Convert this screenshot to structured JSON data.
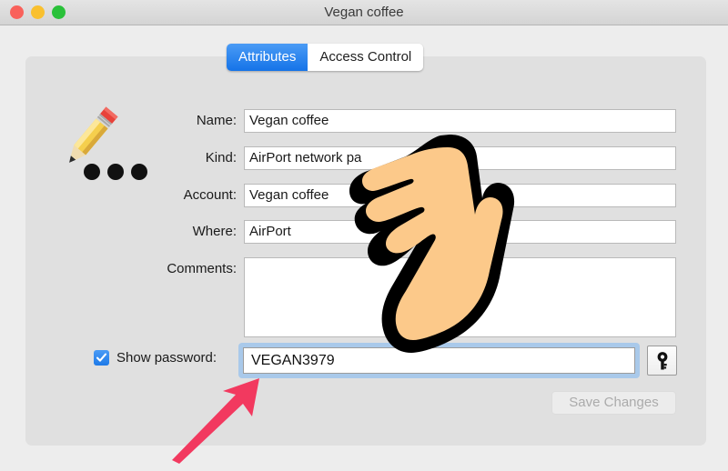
{
  "window": {
    "title": "Vegan coffee",
    "traffic_lights": [
      {
        "name": "close",
        "color": "#f9615b"
      },
      {
        "name": "minimize",
        "color": "#f9c02f"
      },
      {
        "name": "zoom",
        "color": "#2ac13a"
      }
    ]
  },
  "tabs": [
    {
      "label": "Attributes",
      "selected": true
    },
    {
      "label": "Access Control",
      "selected": false
    }
  ],
  "item_icon": {
    "name": "pencil-icon",
    "dots_count": 3
  },
  "form": {
    "rows": [
      {
        "label": "Name:",
        "value": "Vegan coffee"
      },
      {
        "label": "Kind:",
        "value": "AirPort network pa"
      },
      {
        "label": "Account:",
        "value": "Vegan coffee"
      },
      {
        "label": "Where:",
        "value": "AirPort"
      },
      {
        "label": "Comments:",
        "value": ""
      }
    ]
  },
  "password": {
    "checkbox_label": "Show password:",
    "checked": true,
    "value": "VEGAN3979",
    "key_button_icon": "key-icon"
  },
  "buttons": {
    "save_label": "Save Changes",
    "save_enabled": false
  },
  "annotations": {
    "hand_cursor": "pointing-down-hand",
    "arrow": "red-arrow-up-right",
    "arrow_color": "#f2395f"
  },
  "colors": {
    "accent_blue": "#1573e8",
    "panel_bg": "#e0e0e0",
    "window_bg": "#ededed",
    "focus_ring": "#a9c9ea"
  }
}
